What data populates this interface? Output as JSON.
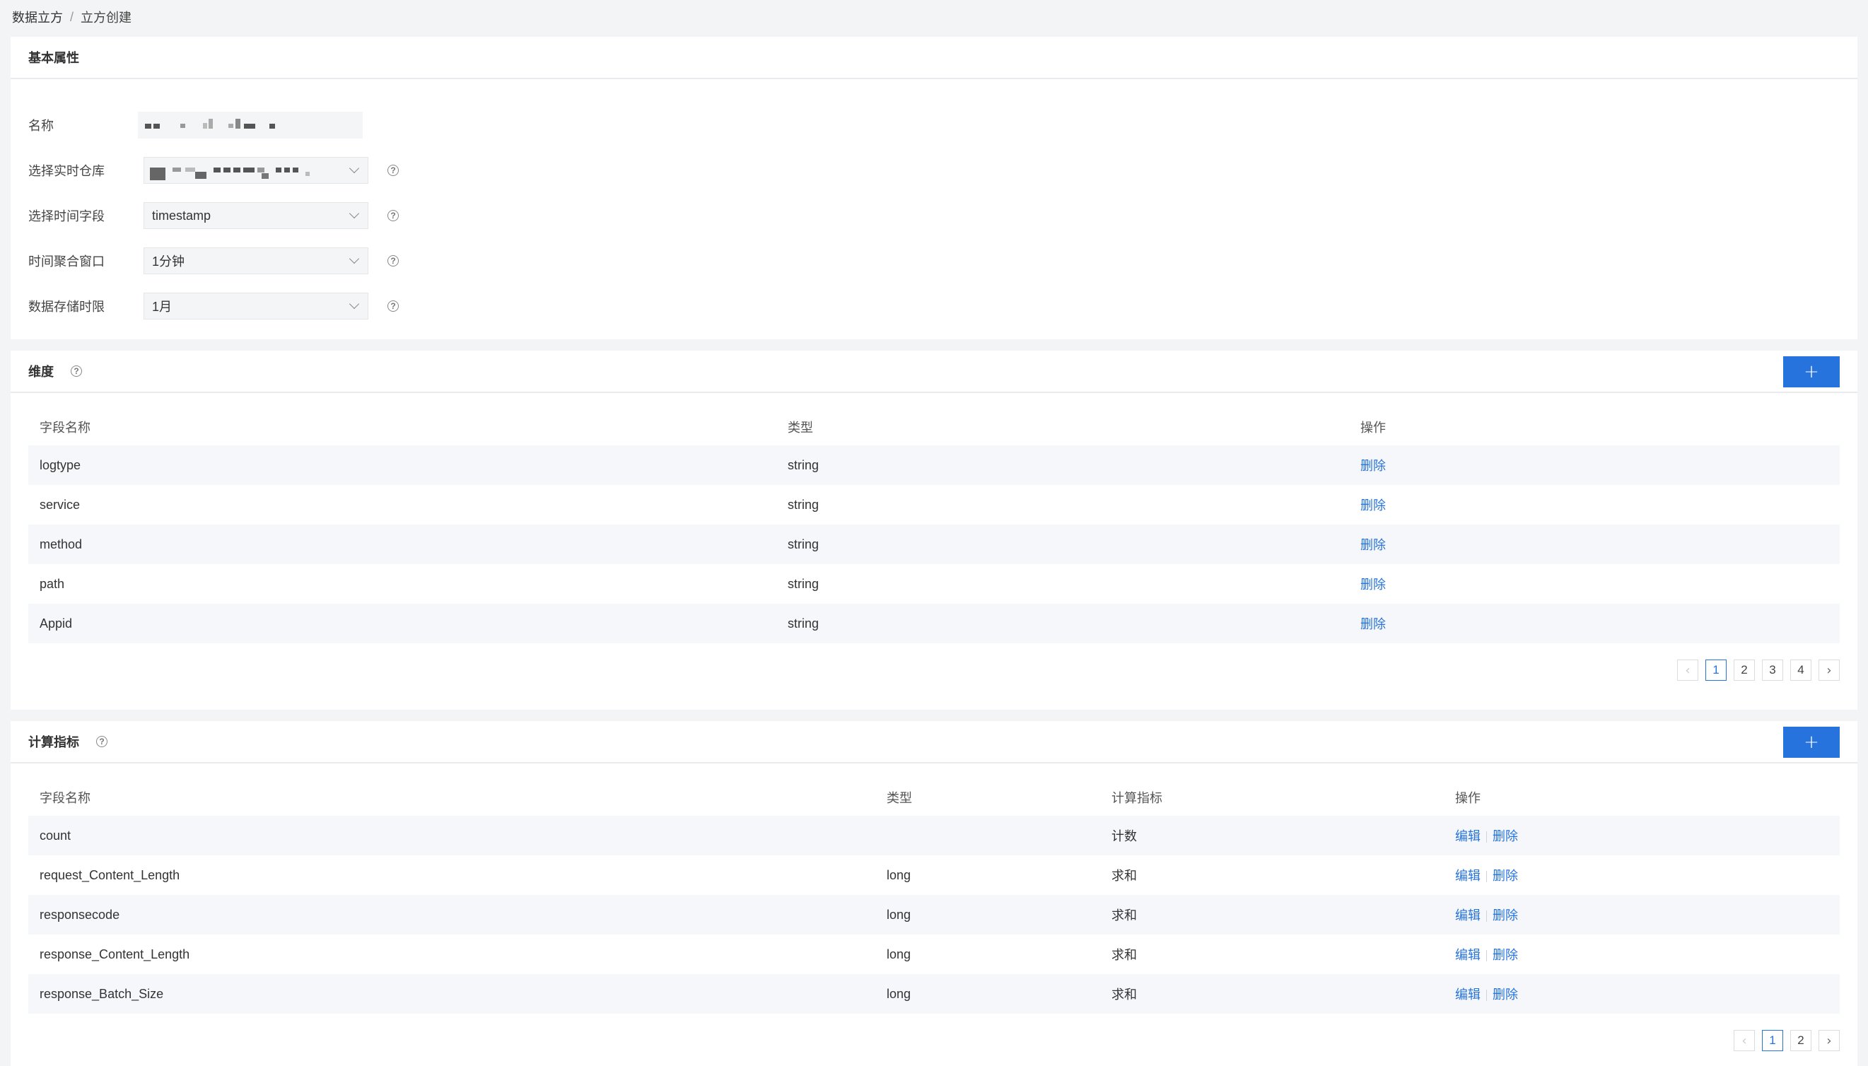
{
  "breadcrumb": {
    "parent": "数据立方",
    "separator": "/",
    "current": "立方创建"
  },
  "basic": {
    "title": "基本属性",
    "fields": {
      "name": {
        "label": "名称",
        "value": ""
      },
      "warehouse": {
        "label": "选择实时仓库",
        "value": ""
      },
      "time_field": {
        "label": "选择时间字段",
        "value": "timestamp"
      },
      "window": {
        "label": "时间聚合窗口",
        "value": "1分钟"
      },
      "retention": {
        "label": "数据存储时限",
        "value": "1月"
      }
    },
    "help_glyph": "?"
  },
  "dimensions": {
    "title": "维度",
    "add_label": "+",
    "columns": [
      "字段名称",
      "类型",
      "操作"
    ],
    "rows": [
      {
        "name": "logtype",
        "type": "string",
        "op": "删除"
      },
      {
        "name": "service",
        "type": "string",
        "op": "删除"
      },
      {
        "name": "method",
        "type": "string",
        "op": "删除"
      },
      {
        "name": "path",
        "type": "string",
        "op": "删除"
      },
      {
        "name": "Appid",
        "type": "string",
        "op": "删除"
      }
    ],
    "pagination": {
      "prev": "‹",
      "pages": [
        "1",
        "2",
        "3",
        "4"
      ],
      "current": "1",
      "next": "›"
    }
  },
  "metrics": {
    "title": "计算指标",
    "add_label": "+",
    "columns": [
      "字段名称",
      "类型",
      "计算指标",
      "操作"
    ],
    "rows": [
      {
        "name": "count",
        "type": "",
        "metric": "计数",
        "edit": "编辑",
        "del": "删除"
      },
      {
        "name": "request_Content_Length",
        "type": "long",
        "metric": "求和",
        "edit": "编辑",
        "del": "删除"
      },
      {
        "name": "responsecode",
        "type": "long",
        "metric": "求和",
        "edit": "编辑",
        "del": "删除"
      },
      {
        "name": "response_Content_Length",
        "type": "long",
        "metric": "求和",
        "edit": "编辑",
        "del": "删除"
      },
      {
        "name": "response_Batch_Size",
        "type": "long",
        "metric": "求和",
        "edit": "编辑",
        "del": "删除"
      }
    ],
    "pagination": {
      "prev": "‹",
      "pages": [
        "1",
        "2"
      ],
      "current": "1",
      "next": "›"
    }
  }
}
